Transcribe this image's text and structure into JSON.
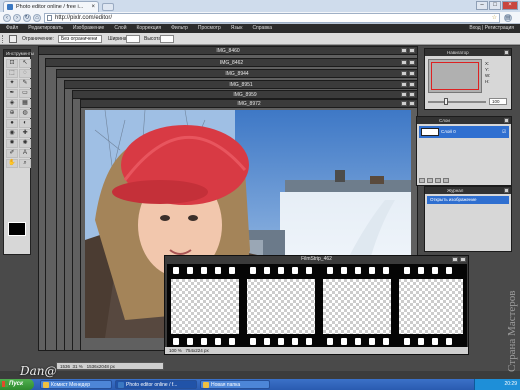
{
  "browser": {
    "tab_title": "Photo editor online / free i...",
    "url": "http://pixlr.com/editor/"
  },
  "menu": {
    "items": [
      "Файл",
      "Редактировать",
      "Изображение",
      "Слой",
      "Коррекция",
      "Фильтр",
      "Просмотр",
      "Язык",
      "Справка"
    ],
    "account": "Вход | Регистрация"
  },
  "options": {
    "restriction_label": "Ограничение:",
    "restriction_value": "Без ограничени",
    "width_label": "Ширина:",
    "height_label": "Высота:"
  },
  "tools": {
    "title": "Инструменты"
  },
  "documents": [
    {
      "title": "IMG_8460"
    },
    {
      "title": "IMG_8462"
    },
    {
      "title": "IMG_8944"
    },
    {
      "title": "IMG_8951"
    },
    {
      "title": "IMG_8959"
    },
    {
      "title": "IMG_8972"
    }
  ],
  "filmstrip": {
    "title": "FilmStrip_462",
    "zoom": "100",
    "size": "754x224 px"
  },
  "doc_status": {
    "left_value": "1536",
    "zoom": "31",
    "size": "1536x2048 px"
  },
  "navigator": {
    "title": "Навигатор",
    "x_label": "X:",
    "y_label": "Y:",
    "w_label": "W:",
    "h_label": "H:",
    "zoom": "100"
  },
  "layers": {
    "title": "Слои",
    "layer_name": "Слой 0"
  },
  "history": {
    "title": "Журнал",
    "item": "Открыть изображение"
  },
  "taskbar": {
    "start": "Пуск",
    "items": [
      "Комист Менедер",
      "Photo editor online / f...",
      "Новая папка"
    ],
    "clock": "20:29"
  },
  "logo": "Dan@",
  "watermark": "Страна Мастеров"
}
